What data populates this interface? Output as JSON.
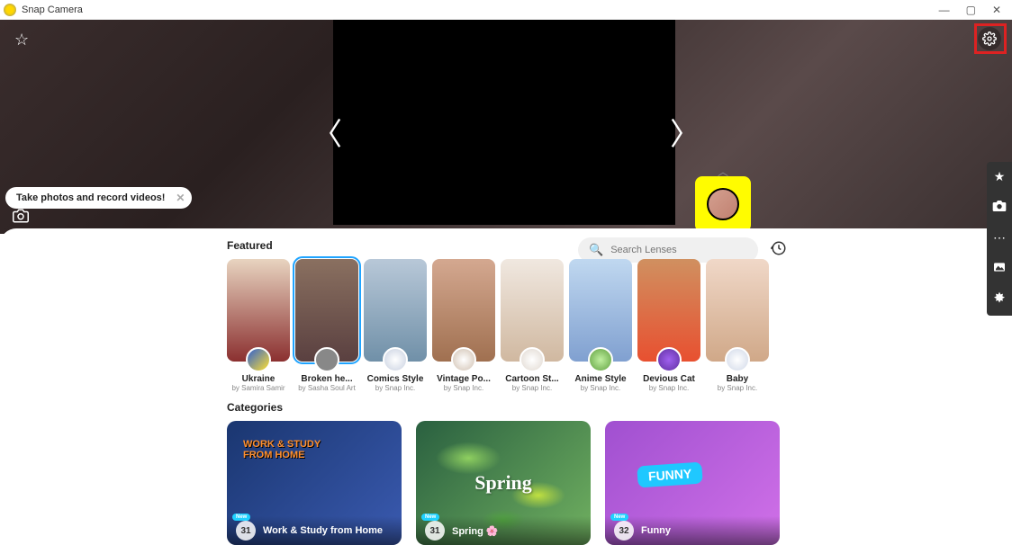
{
  "window": {
    "title": "Snap Camera",
    "tooltip": "Take photos and record videos!"
  },
  "search": {
    "placeholder": "Search Lenses"
  },
  "sections": {
    "featured": "Featured",
    "categories": "Categories"
  },
  "lenses": [
    {
      "name": "Ukraine",
      "author": "by Samira Samir"
    },
    {
      "name": "Broken he...",
      "author": "by Sasha Soul Art"
    },
    {
      "name": "Comics Style",
      "author": "by Snap Inc."
    },
    {
      "name": "Vintage Po...",
      "author": "by Snap Inc."
    },
    {
      "name": "Cartoon St...",
      "author": "by Snap Inc."
    },
    {
      "name": "Anime Style",
      "author": "by Snap Inc."
    },
    {
      "name": "Devious Cat",
      "author": "by Snap Inc."
    },
    {
      "name": "Baby",
      "author": "by Snap Inc."
    }
  ],
  "categories": [
    {
      "count": "31",
      "title": "Work & Study from Home",
      "deco": "WORK & STUDY\nFROM HOME",
      "badge": "New"
    },
    {
      "count": "31",
      "title": "Spring 🌸",
      "deco": "Spring",
      "badge": "New"
    },
    {
      "count": "32",
      "title": "Funny",
      "deco": "FUNNY",
      "badge": "New"
    }
  ],
  "selected_lens_index": 1
}
